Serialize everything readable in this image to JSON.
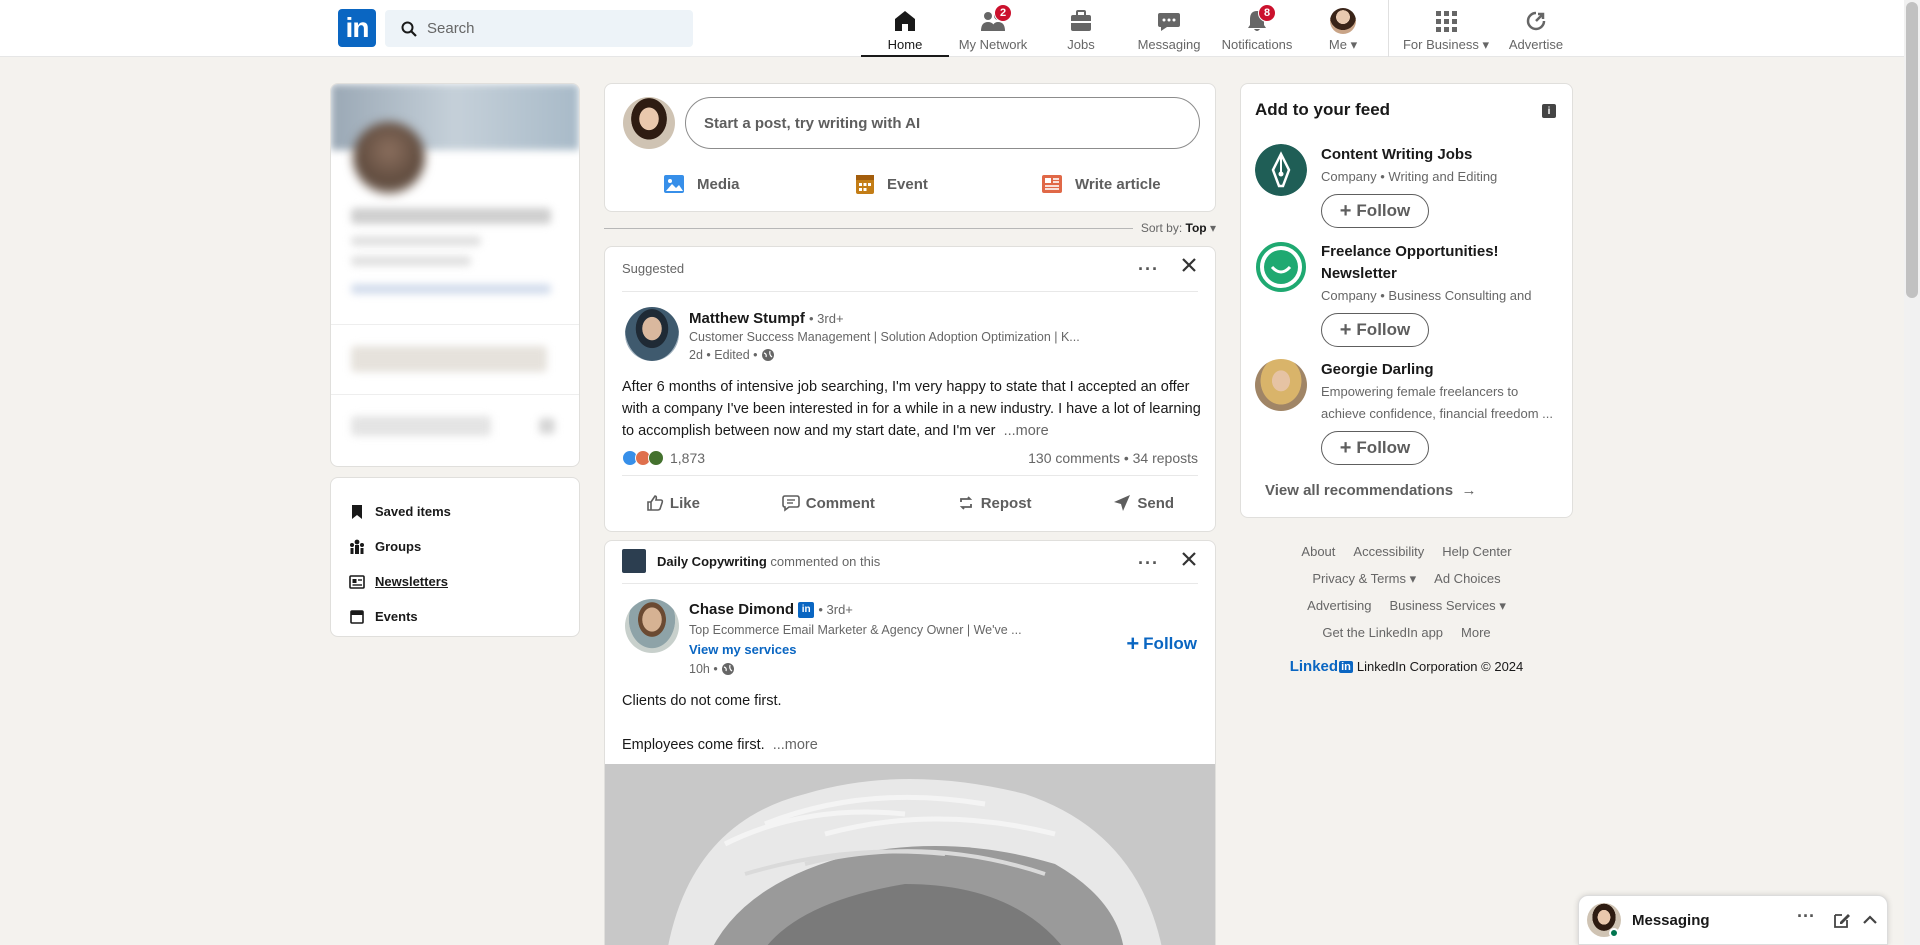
{
  "nav": {
    "logo": "in",
    "search_placeholder": "Search",
    "items": [
      {
        "label": "Home",
        "icon": "home-icon",
        "active": true
      },
      {
        "label": "My Network",
        "icon": "network-icon",
        "badge": "2"
      },
      {
        "label": "Jobs",
        "icon": "briefcase-icon"
      },
      {
        "label": "Messaging",
        "icon": "chat-icon"
      },
      {
        "label": "Notifications",
        "icon": "bell-icon",
        "badge": "8"
      },
      {
        "label": "Me",
        "icon": "avatar"
      },
      {
        "label": "For Business",
        "icon": "grid-icon"
      },
      {
        "label": "Advertise",
        "icon": "advertise-icon"
      }
    ]
  },
  "shortcuts": [
    {
      "label": "Saved items",
      "icon": "bookmark-icon"
    },
    {
      "label": "Groups",
      "icon": "groups-icon"
    },
    {
      "label": "Newsletters",
      "icon": "newsletter-icon"
    },
    {
      "label": "Events",
      "icon": "calendar-icon"
    }
  ],
  "share": {
    "placeholder": "Start a post, try writing with AI",
    "actions": [
      "Media",
      "Event",
      "Write article"
    ]
  },
  "sort": {
    "label": "Sort by:",
    "value": "Top"
  },
  "post1": {
    "header": "Suggested",
    "author": "Matthew Stumpf",
    "degree": "• 3rd+",
    "headline": "Customer Success Management | Solution Adoption Optimization | K...",
    "meta": "2d • Edited •",
    "text": "After 6 months of intensive job searching, I'm very happy to state that I accepted an offer with a company I've been interested in for a while in a new industry. I have a lot of learning to accomplish between now and my start date, and I'm ver",
    "more": "...more",
    "reactions": "1,873",
    "counts": "130 comments • 34 reposts",
    "actions": [
      "Like",
      "Comment",
      "Repost",
      "Send"
    ]
  },
  "post2": {
    "header_actor": "Daily Copywriting",
    "header_action": "commented on this",
    "author": "Chase Dimond",
    "degree": "• 3rd+",
    "headline": "Top Ecommerce Email Marketer & Agency Owner | We've ...",
    "link": "View my services",
    "meta": "10h •",
    "follow": "Follow",
    "line1": "Clients do not come first.",
    "line2": "Employees come first.",
    "more": "...more"
  },
  "feed": {
    "title": "Add to your feed",
    "recs": [
      {
        "name": "Content Writing Jobs",
        "desc": "Company • Writing and Editing",
        "follow": "Follow"
      },
      {
        "name": "Freelance Opportunities! Newsletter",
        "desc": "Company • Business Consulting and",
        "follow": "Follow"
      },
      {
        "name": "Georgie Darling",
        "desc": "Empowering female freelancers to achieve confidence, financial freedom ...",
        "follow": "Follow"
      }
    ],
    "view_all": "View all recommendations"
  },
  "footer": {
    "row1": [
      "About",
      "Accessibility",
      "Help Center"
    ],
    "row2": [
      "Privacy & Terms",
      "Ad Choices"
    ],
    "row3": [
      "Advertising",
      "Business Services"
    ],
    "row4": [
      "Get the LinkedIn app",
      "More"
    ],
    "brand": "Linked",
    "brand_box": "in",
    "copyright": "LinkedIn Corporation © 2024"
  },
  "messaging": {
    "label": "Messaging"
  },
  "colors": {
    "brand": "#0a66c2",
    "badge": "#cb112d",
    "background": "#f4f2ee"
  }
}
